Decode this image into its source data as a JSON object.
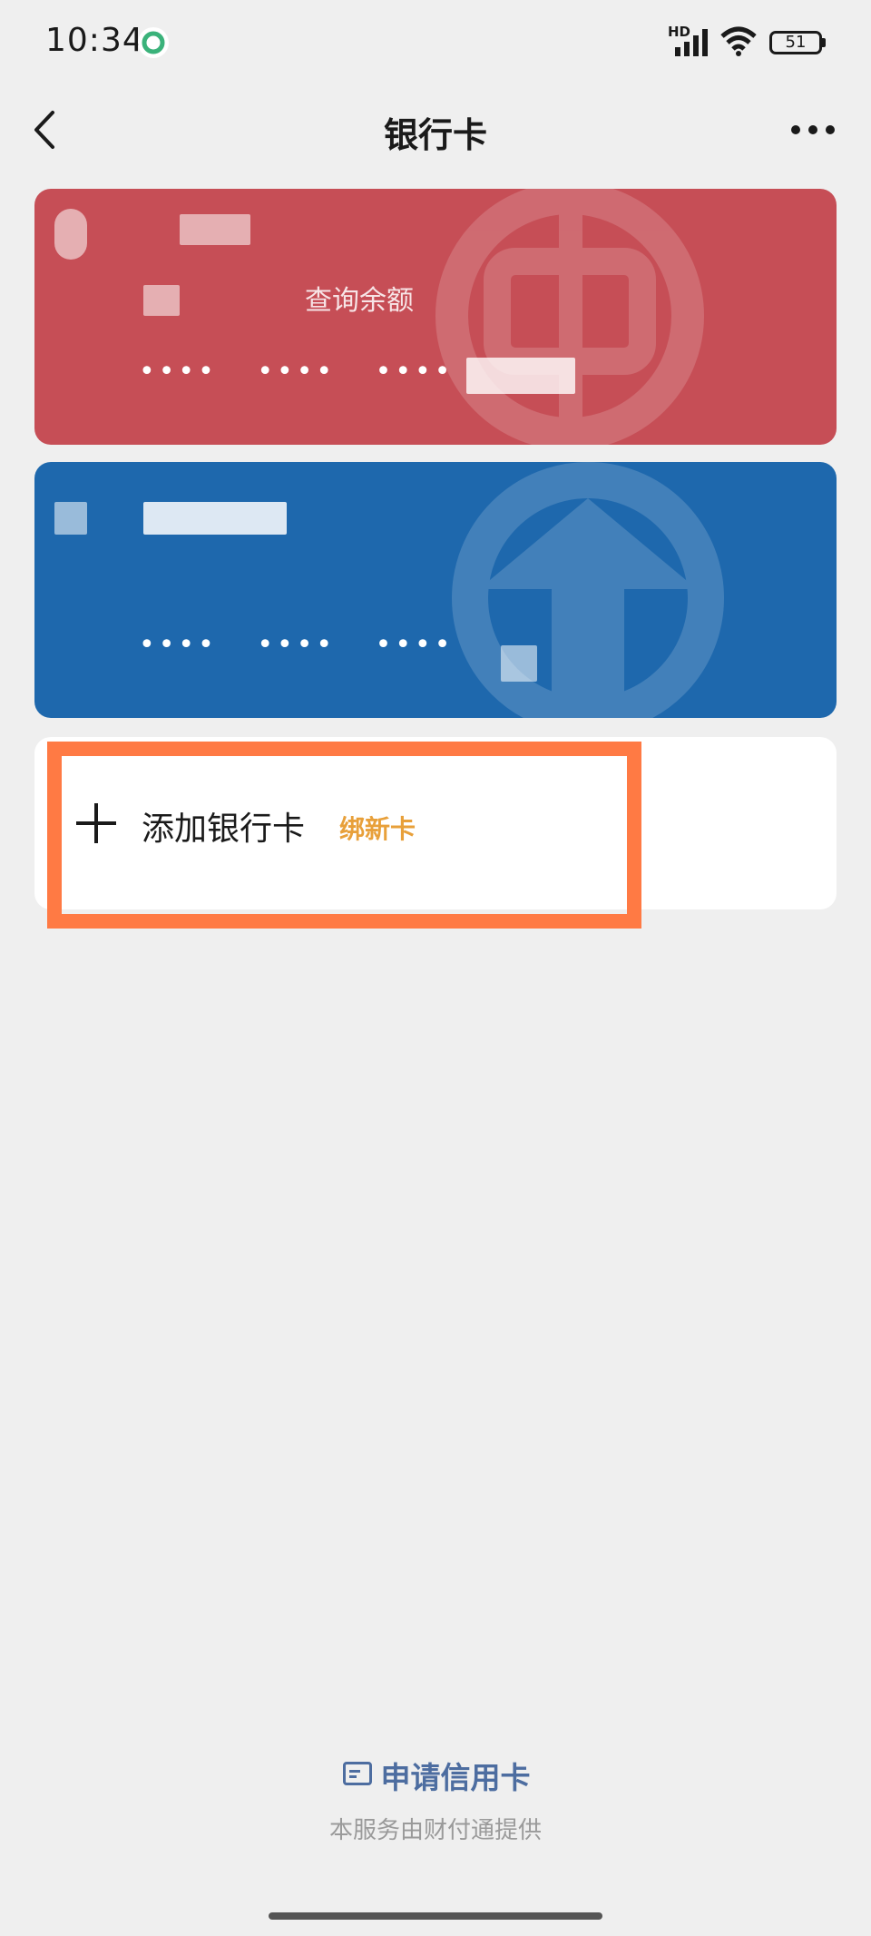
{
  "status_bar": {
    "time": "10:34",
    "network": "HD",
    "battery": "51",
    "icons": [
      "app-indicator-icon",
      "signal-icon",
      "wifi-icon",
      "battery-icon"
    ]
  },
  "nav": {
    "title": "银行卡",
    "back_icon": "chevron-left-icon",
    "more_icon": "more-icon"
  },
  "cards": [
    {
      "color": "#c64e56",
      "action": "查询余额",
      "number_masked": [
        "••••",
        "••••",
        "••••"
      ]
    },
    {
      "color": "#1e68ad",
      "number_masked": [
        "••••",
        "••••",
        "••••"
      ]
    }
  ],
  "add_card": {
    "label": "添加银行卡",
    "promo": "绑新卡",
    "highlight_color": "#ff7a44"
  },
  "footer": {
    "apply_label": "申请信用卡",
    "provider": "本服务由财付通提供"
  },
  "colors": {
    "background": "#efefef",
    "accent_link": "#4d6da0",
    "promo": "#e8a03a"
  }
}
